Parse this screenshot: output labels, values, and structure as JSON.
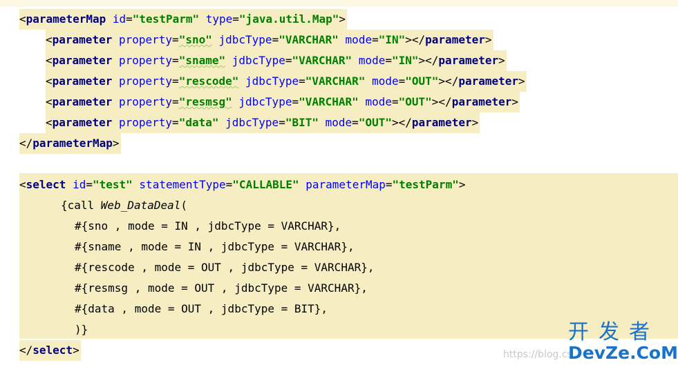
{
  "block1": {
    "open": {
      "tag": "parameterMap",
      "a1": "id",
      "v1": "\"testParm\"",
      "a2": "type",
      "v2": "\"java.util.Map\""
    },
    "params": [
      {
        "prop": "\"sno\"",
        "jdbc": "\"VARCHAR\"",
        "mode": "\"IN\""
      },
      {
        "prop": "\"sname\"",
        "jdbc": "\"VARCHAR\"",
        "mode": "\"IN\""
      },
      {
        "prop": "\"rescode\"",
        "jdbc": "\"VARCHAR\"",
        "mode": "\"OUT\""
      },
      {
        "prop": "\"resmsg\"",
        "jdbc": "\"VARCHAR\"",
        "mode": "\"OUT\""
      },
      {
        "prop": "\"data\"",
        "jdbc": "\"BIT\"",
        "mode": "\"OUT\""
      }
    ],
    "param_tag": "parameter",
    "attr_property": "property",
    "attr_jdbc": "jdbcType",
    "attr_mode": "mode",
    "close": "parameterMap"
  },
  "block2": {
    "open": {
      "tag": "select",
      "a1": "id",
      "v1": "\"test\"",
      "a2": "statementType",
      "v2": "\"CALLABLE\"",
      "a3": "parameterMap",
      "v3": "\"testParm\""
    },
    "call_prefix": "{call ",
    "call_fn": "Web_DataDeal",
    "call_paren": "(",
    "args": [
      "#{sno , mode = IN , jdbcType = VARCHAR},",
      "#{sname , mode = IN , jdbcType = VARCHAR},",
      "#{rescode , mode = OUT , jdbcType = VARCHAR},",
      "#{resmsg , mode = OUT , jdbcType = VARCHAR},",
      "#{data , mode = OUT , jdbcType = BIT},"
    ],
    "call_close": ")}",
    "close": "select"
  },
  "watermark": {
    "cn": "开发者",
    "en": "DevZe.CoM",
    "url": "https://blog.cs"
  },
  "colors": {
    "tag": "#000080",
    "attr": "#0000ff",
    "value": "#008000",
    "highlight": "#f6edc2"
  }
}
